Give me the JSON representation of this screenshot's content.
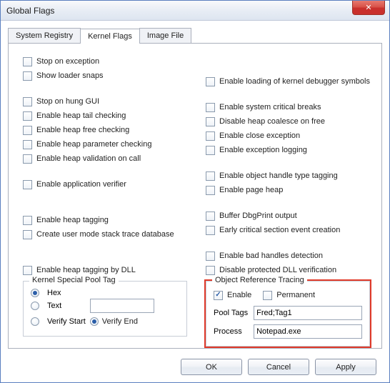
{
  "window": {
    "title": "Global Flags"
  },
  "tabs": [
    {
      "label": "System Registry",
      "active": false
    },
    {
      "label": "Kernel Flags",
      "active": true
    },
    {
      "label": "Image File",
      "active": false
    }
  ],
  "left_checks": {
    "stop_exception": "Stop on exception",
    "show_loader_snaps": "Show loader snaps",
    "stop_hung_gui": "Stop on hung GUI",
    "heap_tail": "Enable heap tail checking",
    "heap_free": "Enable heap free checking",
    "heap_param": "Enable heap parameter checking",
    "heap_valid_call": "Enable heap validation on call",
    "app_verifier": "Enable application verifier",
    "heap_tagging": "Enable heap tagging",
    "stack_trace_db": "Create user mode stack trace database",
    "heap_tagging_dll": "Enable heap tagging by DLL"
  },
  "right_checks": {
    "kernel_dbg_symbols": "Enable loading of kernel debugger symbols",
    "sys_critical_breaks": "Enable system critical breaks",
    "disable_heap_coalesce": "Disable heap coalesce on free",
    "close_exception": "Enable close exception",
    "exception_logging": "Enable exception logging",
    "obj_handle_type_tag": "Enable object handle type tagging",
    "page_heap": "Enable page heap",
    "buffer_dbgprint": "Buffer DbgPrint output",
    "early_crit_section": "Early critical section event creation",
    "bad_handles": "Enable bad handles detection",
    "disable_protected_dll": "Disable protected DLL verification"
  },
  "kspt": {
    "legend": "Kernel Special Pool Tag",
    "hex": "Hex",
    "text": "Text",
    "verify_start": "Verify Start",
    "verify_end": "Verify End",
    "tag_value": ""
  },
  "ort": {
    "legend": "Object Reference Tracing",
    "enable": "Enable",
    "permanent": "Permanent",
    "pool_tags_label": "Pool Tags",
    "pool_tags_value": "Fred;Tag1",
    "process_label": "Process",
    "process_value": "Notepad.exe"
  },
  "buttons": {
    "ok": "OK",
    "cancel": "Cancel",
    "apply": "Apply"
  },
  "close_glyph": "✕"
}
